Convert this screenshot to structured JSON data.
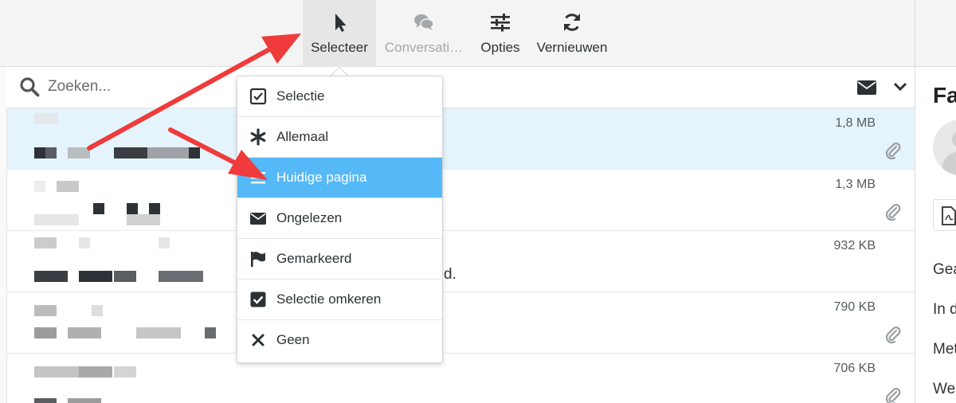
{
  "toolbar": {
    "buttons": [
      {
        "label": "Selecteer",
        "icon": "cursor-icon"
      },
      {
        "label": "Conversati…",
        "icon": "chat-icon"
      },
      {
        "label": "Opties",
        "icon": "sliders-icon"
      },
      {
        "label": "Vernieuwen",
        "icon": "refresh-icon"
      }
    ]
  },
  "search": {
    "placeholder": "Zoeken..."
  },
  "messages": [
    {
      "size": "1,8 MB",
      "attachment": true
    },
    {
      "size": "1,3 MB",
      "attachment": true
    },
    {
      "size": "932 KB",
      "attachment": false,
      "snippet_end": "d."
    },
    {
      "size": "790 KB",
      "attachment": true
    },
    {
      "size": "706 KB",
      "attachment": true
    }
  ],
  "select_menu": {
    "items": [
      {
        "label": "Selectie",
        "icon": "checkbox-empty-icon"
      },
      {
        "label": "Allemaal",
        "icon": "asterisk-icon"
      },
      {
        "label": "Huidige pagina",
        "icon": "list-icon",
        "active": true
      },
      {
        "label": "Ongelezen",
        "icon": "envelope-icon"
      },
      {
        "label": "Gemarkeerd",
        "icon": "flag-icon"
      },
      {
        "label": "Selectie omkeren",
        "icon": "checkbox-checked-icon"
      },
      {
        "label": "Geen",
        "icon": "close-icon"
      }
    ]
  },
  "preview": {
    "title": "Fa",
    "lines": [
      "Gea",
      "In d",
      "Met",
      "Wel"
    ]
  },
  "colors": {
    "accent": "#55b8f7",
    "selected_row": "#e5f4fc",
    "annotation_arrow": "#ef3b3b"
  }
}
